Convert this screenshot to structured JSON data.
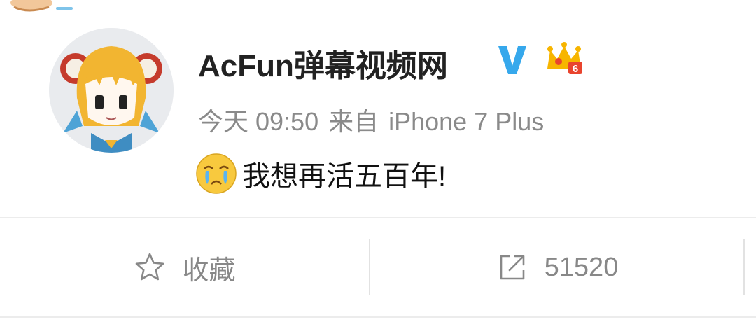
{
  "post": {
    "username": "AcFun弹幕视频网",
    "time": "今天 09:50",
    "source_prefix": "来自",
    "source_device": "iPhone 7 Plus",
    "text": "我想再活五百年!",
    "emoji": "crying-face-emoji"
  },
  "badges": {
    "verified": "V",
    "verified_color": "#36a8ec",
    "member_level": "6",
    "crown_color": "#f7b500"
  },
  "actions": {
    "favorite_label": "收藏",
    "share_count": "51520"
  },
  "icons": [
    "star-outline-icon",
    "share-out-icon",
    "verified-v-icon",
    "vip-crown-icon"
  ]
}
